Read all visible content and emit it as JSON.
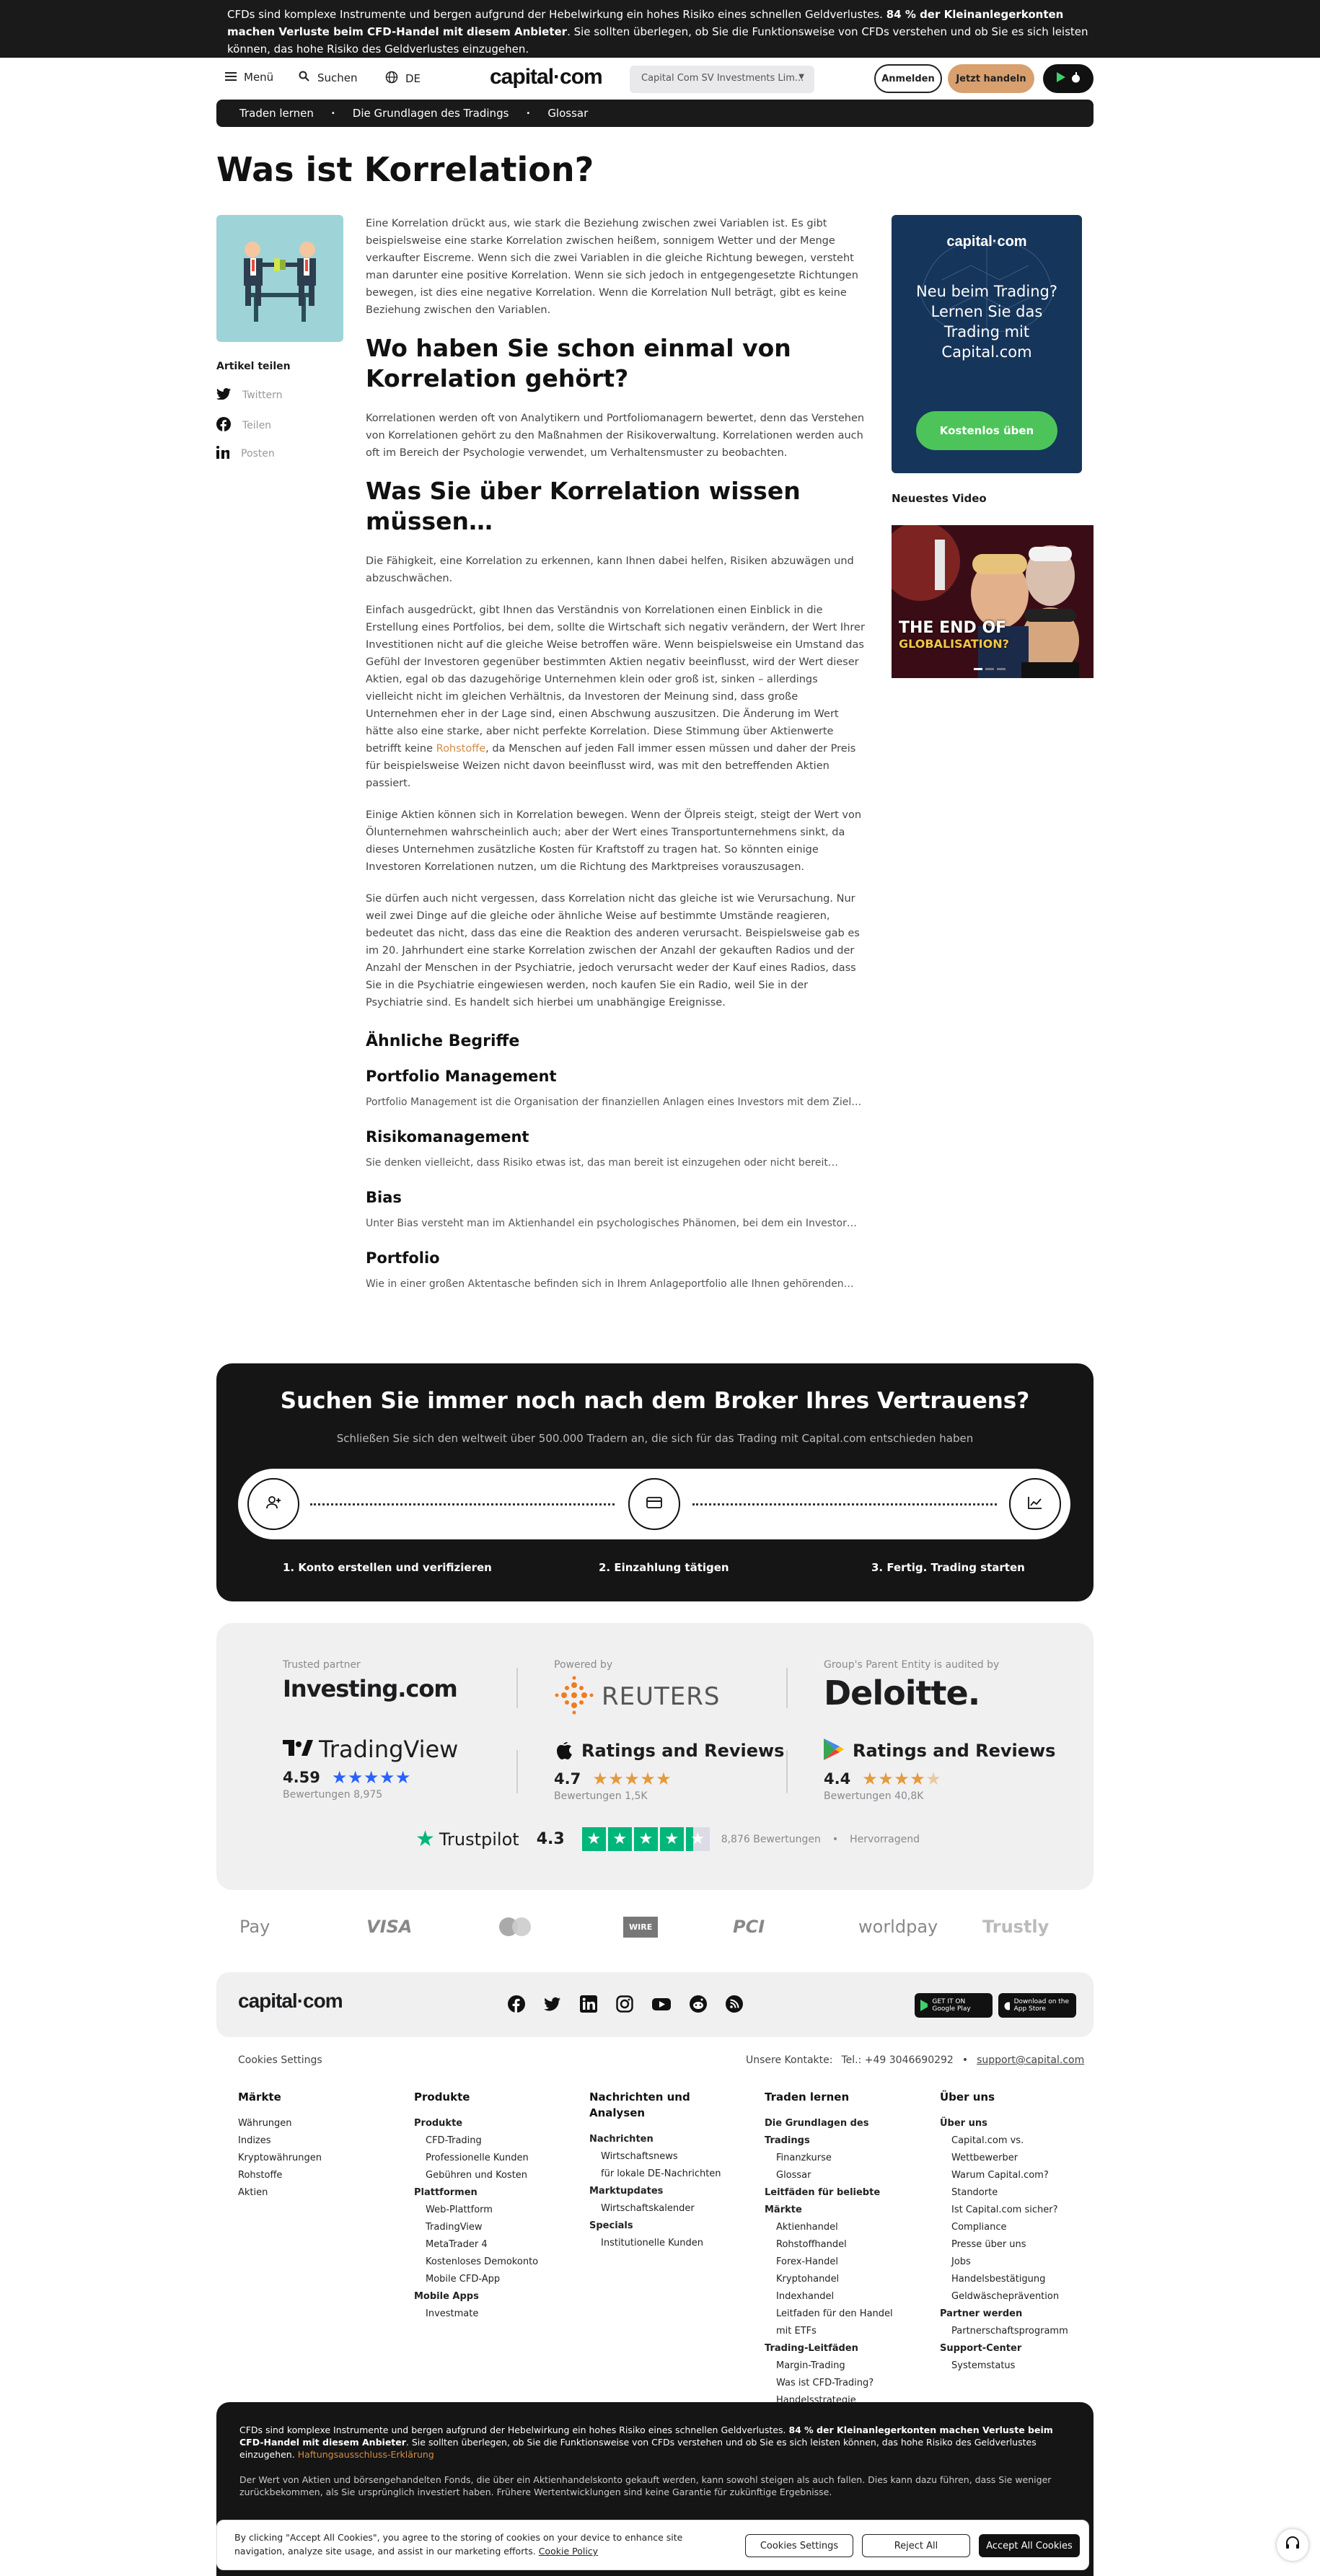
{
  "risk_banner": {
    "part1": "CFDs sind komplexe Instrumente und bergen aufgrund der Hebelwirkung ein hohes Risiko eines schnellen Geldverlustes.",
    "bold": "84 % der Kleinanlegerkonten machen Verluste beim CFD-Handel mit diesem Anbieter",
    "part2": ". Sie sollten überlegen, ob Sie die Funktionsweise von CFDs verstehen und ob Sie es sich leisten können, das hohe Risiko des Geldverlustes einzugehen."
  },
  "header": {
    "menu": "Menü",
    "search": "Suchen",
    "lang": "DE",
    "logo": "capital·com",
    "entity": "Capital Com SV Investments Lim...",
    "login": "Anmelden",
    "trade": "Jetzt handeln"
  },
  "breadcrumb": [
    "Traden lernen",
    "Die Grundlagen des Tradings",
    "Glossar"
  ],
  "page_title": "Was ist Korrelation?",
  "share": {
    "title": "Artikel teilen",
    "twitter": "Twittern",
    "facebook": "Teilen",
    "linkedin": "Posten"
  },
  "article": {
    "intro": "Eine Korrelation drückt aus, wie stark die Beziehung zwischen zwei Variablen ist. Es gibt beispielsweise eine starke Korrelation zwischen heißem, sonnigem Wetter und der Menge verkaufter Eiscreme. Wenn sich die zwei Variablen in die gleiche Richtung bewegen, versteht man darunter eine positive Korrelation. Wenn sie sich jedoch in entgegengesetzte Richtungen bewegen, ist dies eine negative Korrelation. Wenn die Korrelation Null beträgt, gibt es keine Beziehung zwischen den Variablen.",
    "h2a": "Wo haben Sie schon einmal von Korrelation gehört?",
    "p2": "Korrelationen werden oft von Analytikern und Portfoliomanagern bewertet, denn das Verstehen von Korrelationen gehört zu den Maßnahmen der Risikoverwaltung. Korrelationen werden auch oft im Bereich der Psychologie verwendet, um Verhaltensmuster zu beobachten.",
    "h2b": "Was Sie über Korrelation wissen müssen…",
    "p3": "Die Fähigkeit, eine Korrelation zu erkennen, kann Ihnen dabei helfen, Risiken abzuwägen und abzuschwächen.",
    "p4a": "Einfach ausgedrückt, gibt Ihnen das Verständnis von Korrelationen einen Einblick in die Erstellung eines Portfolios, bei dem, sollte die Wirtschaft sich negativ verändern, der Wert Ihrer Investitionen nicht auf die gleiche Weise betroffen wäre. Wenn beispielsweise ein Umstand das Gefühl der Investoren gegenüber bestimmten Aktien negativ beeinflusst, wird der Wert dieser Aktien, egal ob das dazugehörige Unternehmen klein oder groß ist, sinken – allerdings vielleicht nicht im gleichen Verhältnis, da Investoren der Meinung sind, dass große Unternehmen eher in der Lage sind, einen Abschwung auszusitzen. Die Änderung im Wert hätte also eine starke, aber nicht perfekte Korrelation. Diese Stimmung über Aktienwerte betrifft keine",
    "p4link": "Rohstoffe",
    "p4b": ", da Menschen auf jeden Fall immer essen müssen und daher der Preis für beispielsweise Weizen nicht davon beeinflusst wird, was mit den betreffenden Aktien passiert.",
    "p5": "Einige Aktien können sich in Korrelation bewegen. Wenn der Ölpreis steigt, steigt der Wert von Ölunternehmen wahrscheinlich auch; aber der Wert eines Transportunternehmens sinkt, da dieses Unternehmen zusätzliche Kosten für Kraftstoff zu tragen hat. So könnten einige Investoren Korrelationen nutzen, um die Richtung des Marktpreises vorauszusagen.",
    "p6": "Sie dürfen auch nicht vergessen, dass Korrelation nicht das gleiche ist wie Verursachung. Nur weil zwei Dinge auf die gleiche oder ähnliche Weise auf bestimmte Umstände reagieren, bedeutet das nicht, dass das eine die Reaktion des anderen verursacht. Beispielsweise gab es im 20. Jahrhundert eine starke Korrelation zwischen der Anzahl der gekauften Radios und der Anzahl der Menschen in der Psychiatrie, jedoch verursacht weder der Kauf eines Radios, dass Sie in die Psychiatrie eingewiesen werden, noch kaufen Sie ein Radio, weil Sie in der Psychiatrie sind. Es handelt sich hierbei um unabhängige Ereignisse.",
    "related_title": "Ähnliche Begriffe",
    "related": [
      {
        "title": "Portfolio Management",
        "desc": "Portfolio Management ist die Organisation der finanziellen Anlagen eines Investors mit dem Ziel…"
      },
      {
        "title": "Risikomanagement",
        "desc": "Sie denken vielleicht, dass Risiko etwas ist, das man bereit ist einzugehen oder nicht bereit…"
      },
      {
        "title": "Bias",
        "desc": "Unter Bias versteht man im Aktienhandel ein psychologisches Phänomen, bei dem ein Investor…"
      },
      {
        "title": "Portfolio",
        "desc": "Wie in einer großen Aktentasche befinden sich in Ihrem Anlageportfolio alle Ihnen gehörenden…"
      }
    ]
  },
  "promo": {
    "logo": "capital·com",
    "text": "Neu beim Trading? Lernen Sie das Trading mit Capital.com",
    "button": "Kostenlos üben"
  },
  "video": {
    "label": "Neuestes Video",
    "caption1": "THE END OF",
    "caption2": "GLOBALISATION?"
  },
  "cta": {
    "title": "Suchen Sie immer noch nach dem Broker Ihres Vertrauens?",
    "subtitle": "Schließen Sie sich den weltweit über 500.000 Tradern an, die sich für das Trading mit Capital.com entschieden haben",
    "step1": "1. Konto erstellen und verifizieren",
    "step2": "2. Einzahlung tätigen",
    "step3": "3. Fertig. Trading starten"
  },
  "trust": {
    "partner_label": "Trusted partner",
    "partner": "Investing.com",
    "powered_label": "Powered by",
    "powered": "REUTERS",
    "audit_label": "Group's Parent Entity is audited by",
    "audit": "Deloitte.",
    "tv_name": "TradingView",
    "tv_score": "4.59",
    "tv_reviews": "Bewertungen 8,975",
    "apple_title": "Ratings and Reviews",
    "apple_score": "4.7",
    "apple_reviews": "Bewertungen 1,5K",
    "gp_title": "Ratings and Reviews",
    "gp_score": "4.4",
    "gp_reviews": "Bewertungen 40,8K",
    "tp_name": "Trustpilot",
    "tp_score": "4.3",
    "tp_reviews": "8,876 Bewertungen",
    "tp_label": "Hervorragend"
  },
  "payments": [
    "Pay",
    "VISA",
    "mastercard",
    "WIRE",
    "PCI",
    "worldpay",
    "Trustly"
  ],
  "footer": {
    "logo": "capital·com",
    "google_play": "GET IT ON Google Play",
    "app_store": "Download on the App Store",
    "cookie_settings": "Cookies Settings",
    "contacts_label": "Unsere Kontakte:",
    "phone": "Tel.: +49 3046690292",
    "email": "support@capital.com",
    "columns": [
      {
        "title": "Märkte",
        "items": [
          {
            "t": "Währungen",
            "s": 0
          },
          {
            "t": "Indizes",
            "s": 0
          },
          {
            "t": "Kryptowährungen",
            "s": 0
          },
          {
            "t": "Rohstoffe",
            "s": 0
          },
          {
            "t": "Aktien",
            "s": 0
          }
        ]
      },
      {
        "title": "Produkte",
        "items": [
          {
            "t": "Produkte",
            "s": 2
          },
          {
            "t": "CFD-Trading",
            "s": 1
          },
          {
            "t": "Professionelle Kunden",
            "s": 1
          },
          {
            "t": "Gebühren und Kosten",
            "s": 1
          },
          {
            "t": "Plattformen",
            "s": 2
          },
          {
            "t": "Web-Plattform",
            "s": 1
          },
          {
            "t": "TradingView",
            "s": 1
          },
          {
            "t": "MetaTrader 4",
            "s": 1
          },
          {
            "t": "Kostenloses Demokonto",
            "s": 1
          },
          {
            "t": "Mobile CFD-App",
            "s": 1
          },
          {
            "t": "Mobile Apps",
            "s": 2
          },
          {
            "t": "Investmate",
            "s": 1
          }
        ]
      },
      {
        "title": "Nachrichten und Analysen",
        "items": [
          {
            "t": "Nachrichten",
            "s": 2
          },
          {
            "t": "Wirtschaftsnews",
            "s": 1
          },
          {
            "t": "für lokale DE-Nachrichten",
            "s": 1
          },
          {
            "t": "Marktupdates",
            "s": 2
          },
          {
            "t": "Wirtschaftskalender",
            "s": 1
          },
          {
            "t": "Specials",
            "s": 2
          },
          {
            "t": "Institutionelle Kunden",
            "s": 1
          }
        ]
      },
      {
        "title": "Traden lernen",
        "items": [
          {
            "t": "Die Grundlagen des Tradings",
            "s": 2
          },
          {
            "t": "Finanzkurse",
            "s": 1
          },
          {
            "t": "Glossar",
            "s": 1
          },
          {
            "t": "Leitfäden für beliebte Märkte",
            "s": 2
          },
          {
            "t": "Aktienhandel",
            "s": 1
          },
          {
            "t": "Rohstoffhandel",
            "s": 1
          },
          {
            "t": "Forex-Handel",
            "s": 1
          },
          {
            "t": "Kryptohandel",
            "s": 1
          },
          {
            "t": "Indexhandel",
            "s": 1
          },
          {
            "t": "Leitfaden für den Handel mit ETFs",
            "s": 1
          },
          {
            "t": "Trading-Leitfäden",
            "s": 2
          },
          {
            "t": "Margin-Trading",
            "s": 1
          },
          {
            "t": "Was ist CFD-Trading?",
            "s": 1
          },
          {
            "t": "Handelsstrategie",
            "s": 1
          }
        ]
      },
      {
        "title": "Über uns",
        "items": [
          {
            "t": "Über uns",
            "s": 2
          },
          {
            "t": "Capital.com vs. Wettbewerber",
            "s": 1
          },
          {
            "t": "Warum Capital.com?",
            "s": 1
          },
          {
            "t": "Standorte",
            "s": 1
          },
          {
            "t": "Ist Capital.com sicher?",
            "s": 1
          },
          {
            "t": "Compliance",
            "s": 1
          },
          {
            "t": "Presse über uns",
            "s": 1
          },
          {
            "t": "Jobs",
            "s": 1
          },
          {
            "t": "Handelsbestätigung",
            "s": 1
          },
          {
            "t": "Geldwäscheprävention",
            "s": 1
          },
          {
            "t": "Partner werden",
            "s": 2
          },
          {
            "t": "Partnerschaftsprogramm",
            "s": 1
          },
          {
            "t": "Support-Center",
            "s": 2
          },
          {
            "t": "Systemstatus",
            "s": 1
          }
        ]
      }
    ]
  },
  "risk_footer": {
    "p1a": "CFDs sind komplexe Instrumente und bergen aufgrund der Hebelwirkung ein hohes Risiko eines schnellen Geldverlustes.",
    "p1b": "84 % der Kleinanlegerkonten machen Verluste beim CFD-Handel mit diesem Anbieter",
    "p1c": ". Sie sollten überlegen, ob Sie die Funktionsweise von CFDs verstehen und ob Sie es sich leisten können, das hohe Risiko des Geldverlustes einzugehen.",
    "p1link": "Haftungsausschluss-Erklärung",
    "p2": "Der Wert von Aktien und börsengehandelten Fonds, die über ein Aktienhandelskonto gekauft werden, kann sowohl steigen als auch fallen. Dies kann dazu führen, dass Sie weniger zurückbekommen, als Sie ursprünglich investiert haben. Frühere Wertentwicklungen sind keine Garantie für zukünftige Ergebnisse."
  },
  "cookie": {
    "text": "By clicking \"Accept All Cookies\", you agree to the storing of cookies on your device to enhance site navigation, analyze site usage, and assist in our marketing efforts.",
    "policy": "Cookie Policy",
    "settings": "Cookies Settings",
    "reject": "Reject All",
    "accept": "Accept All Cookies"
  }
}
